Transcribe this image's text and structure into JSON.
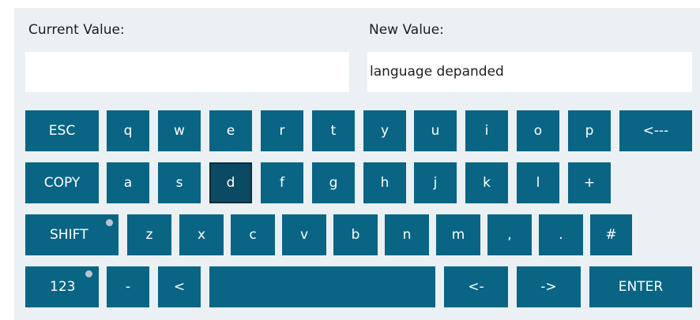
{
  "fields": {
    "current_label": "Current Value:",
    "current_value": "",
    "new_label": "New Value:",
    "new_value": "language depanded"
  },
  "keyboard": {
    "row1": [
      "ESC",
      "q",
      "w",
      "e",
      "r",
      "t",
      "y",
      "u",
      "i",
      "o",
      "p",
      "<---"
    ],
    "row2": [
      "COPY",
      "a",
      "s",
      "d",
      "f",
      "g",
      "h",
      "j",
      "k",
      "l",
      "+"
    ],
    "row3": [
      "SHIFT",
      "z",
      "x",
      "c",
      "v",
      "b",
      "n",
      "m",
      ",",
      ".",
      "#"
    ],
    "row4": [
      "123",
      "-",
      "<",
      "",
      "<-",
      "->",
      "ENTER"
    ],
    "selected_key": "d"
  },
  "colors": {
    "key_bg": "#0a6585",
    "key_selected_bg": "#0b4a63",
    "panel_bg": "#eaf0f4"
  }
}
